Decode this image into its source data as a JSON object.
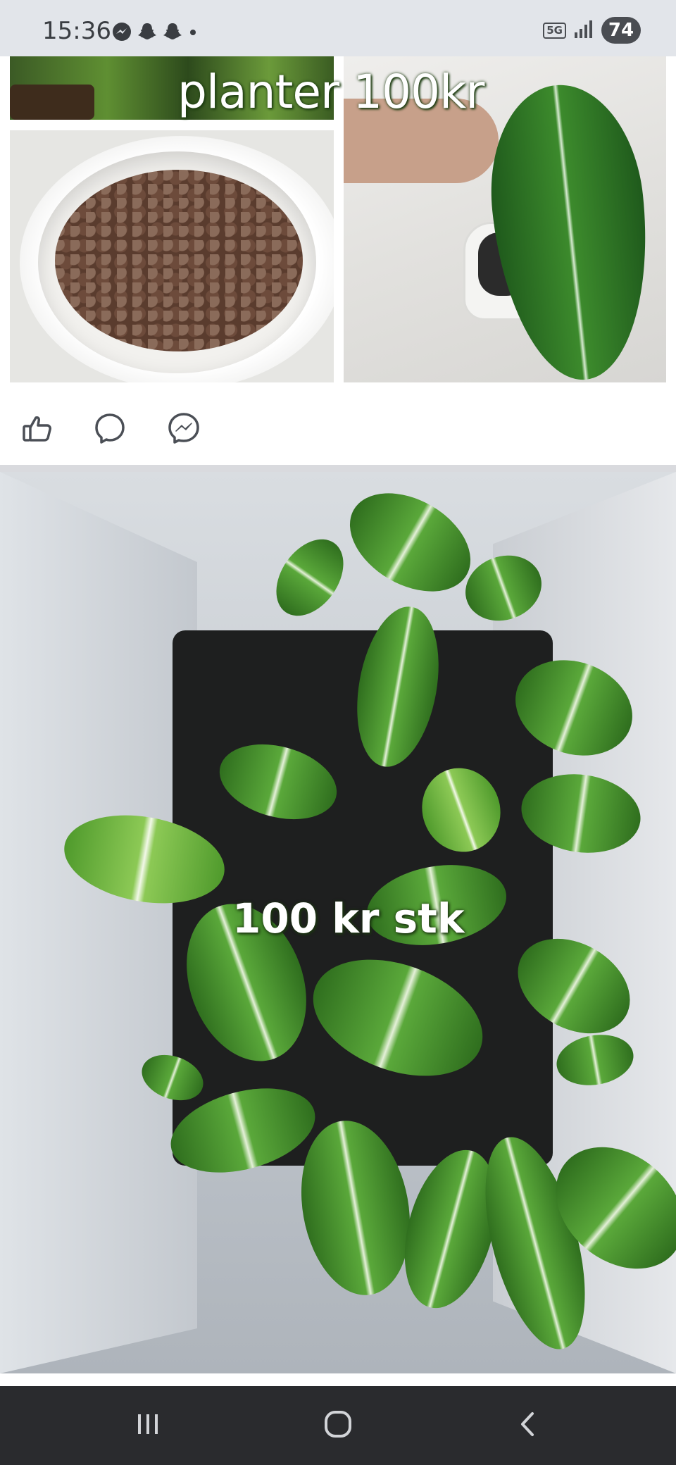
{
  "status_bar": {
    "time": "15:36",
    "notification_icons": [
      "messenger-icon",
      "snapchat-icon",
      "snapchat-icon",
      "dot"
    ],
    "network": "5G",
    "battery": "74"
  },
  "post1": {
    "image_caption": "planter 100kr",
    "actions": {
      "like": "like-icon",
      "comment": "comment-icon",
      "share": "messenger-icon"
    }
  },
  "post2": {
    "image_caption": "100 kr stk"
  },
  "nav": {
    "recent": "recent-apps-icon",
    "home": "home-icon",
    "back": "back-icon"
  }
}
